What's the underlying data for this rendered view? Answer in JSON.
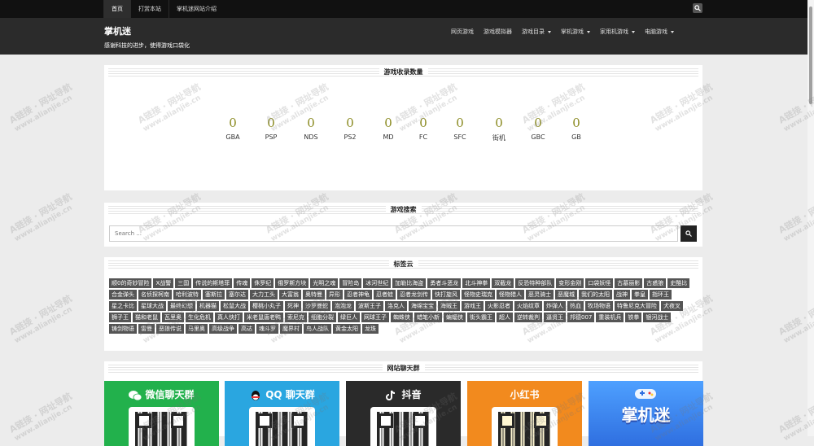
{
  "topbar": {
    "nav": [
      "首页",
      "打赏本站",
      "掌机迷网站介绍"
    ]
  },
  "header": {
    "title": "掌机迷",
    "tagline": "感谢科技的进步，使得游戏口袋化",
    "nav": [
      {
        "label": "网页游戏",
        "dropdown": false
      },
      {
        "label": "游戏模拟器",
        "dropdown": false
      },
      {
        "label": "游戏目录",
        "dropdown": true
      },
      {
        "label": "掌机游戏",
        "dropdown": true
      },
      {
        "label": "家用机游戏",
        "dropdown": true
      },
      {
        "label": "电脑游戏",
        "dropdown": true
      }
    ]
  },
  "stats": {
    "title": "游戏收录数量",
    "items": [
      {
        "value": "0",
        "label": "GBA"
      },
      {
        "value": "0",
        "label": "PSP"
      },
      {
        "value": "0",
        "label": "NDS"
      },
      {
        "value": "0",
        "label": "PS2"
      },
      {
        "value": "0",
        "label": "MD"
      },
      {
        "value": "0",
        "label": "FC"
      },
      {
        "value": "0",
        "label": "SFC"
      },
      {
        "value": "0",
        "label": "街机"
      },
      {
        "value": "0",
        "label": "GBC"
      },
      {
        "value": "0",
        "label": "GB"
      }
    ]
  },
  "search": {
    "title": "游戏搜索",
    "placeholder": "Search ..."
  },
  "tagcloud": {
    "title": "标签云",
    "tags": [
      "顺0的奇妙冒险",
      "X战警",
      "三国",
      "传说的斯塔菲",
      "传魂",
      "侏罗纪",
      "俄罗斯方块",
      "光明之魂",
      "冒险岛",
      "冰河世纪",
      "加勒比海盗",
      "勇者斗恶龙",
      "北斗神拳",
      "双截龙",
      "反恐特种部队",
      "变形金刚",
      "口袋妖怪",
      "古墓丽影",
      "古惑狼",
      "史酷比",
      "合金弹头",
      "名侦探柯南",
      "哈利波特",
      "塞斯拉",
      "塞尔达",
      "大力工头",
      "大富翁",
      "奥特曼",
      "异形",
      "忍者神龟",
      "忍者蛙",
      "忍者龙剑传",
      "快打旋风",
      "怪物史瑞克",
      "怪物猎人",
      "恶灵骑士",
      "恶魔城",
      "我们的太阳",
      "战神",
      "拳皇",
      "指环王",
      "星之卡比",
      "星球大战",
      "最终幻想",
      "机器猫",
      "松鼠大战",
      "樱桃小丸子",
      "死神",
      "沙罗曼蛇",
      "泡泡龙",
      "波斯王子",
      "洛克人",
      "海绵宝宝",
      "海贼王",
      "游戏王",
      "火影忍者",
      "火焰纹章",
      "炸弹人",
      "热血",
      "牧场物语",
      "特鲁尼克大冒险",
      "犬夜叉",
      "狮子王",
      "猫和老鼠",
      "瓦里奥",
      "生化危机",
      "真人快打",
      "米老鼠唐老鸭",
      "索尼克",
      "细胞分裂",
      "绿巨人",
      "网球王子",
      "蜘蛛侠",
      "蜡笔小新",
      "蝙蝠侠",
      "街头霸王",
      "超人",
      "逆转裁判",
      "逼贤王",
      "邦德007",
      "重装机兵",
      "铁拳",
      "银河战士",
      "铸剑物语",
      "雷曼",
      "恶狼传说",
      "马里奥",
      "高级战争",
      "高达",
      "魂斗罗",
      "魔界村",
      "鸟人战队",
      "黄金太阳",
      "龙珠"
    ]
  },
  "chat": {
    "title": "网站聊天群",
    "cards": [
      {
        "label": "微信聊天群",
        "color": "#22b14c",
        "icon": "wechat-icon"
      },
      {
        "label": "QQ 聊天群",
        "color": "#2aa6e0",
        "icon": "qq-icon"
      },
      {
        "label": "抖音",
        "color": "#2a2a2a",
        "icon": "tiktok-icon"
      },
      {
        "label": "小红书",
        "color": "#f28a1e",
        "icon": ""
      },
      {
        "label": "掌机迷",
        "color": "#3a7df0",
        "icon": "gamepad-icon"
      }
    ]
  },
  "watermark": {
    "line1": "A链接 · 网址导航",
    "line2": "www.alianjie.cn"
  }
}
